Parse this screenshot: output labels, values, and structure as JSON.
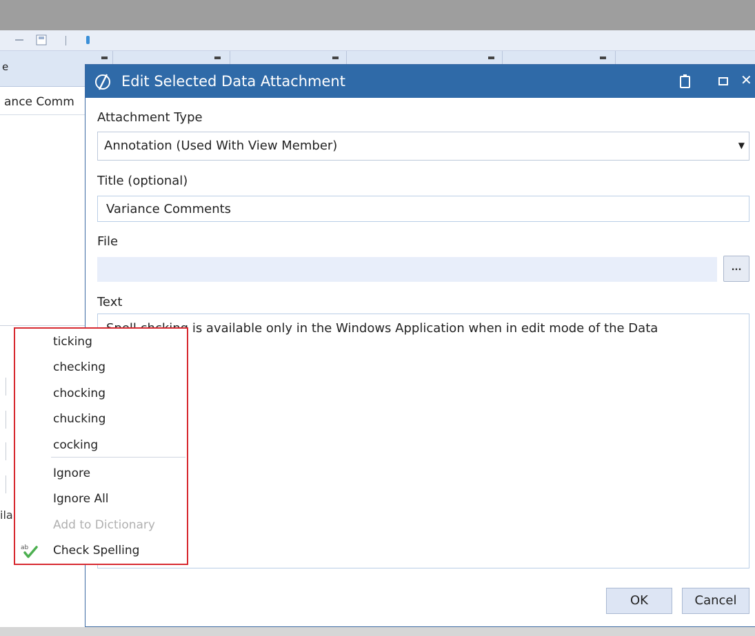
{
  "background": {
    "grid_header_label": "e",
    "grid_cell_text": "ance Comm",
    "side_text": "ila"
  },
  "dialog": {
    "title": "Edit Selected Data Attachment",
    "attachment_type": {
      "label": "Attachment Type",
      "value": "Annotation (Used With View Member)"
    },
    "title_field": {
      "label": "Title (optional)",
      "value": "Variance Comments"
    },
    "file_field": {
      "label": "File",
      "value": "",
      "browse_label": "..."
    },
    "text_field": {
      "label": "Text",
      "value": "Spell chcking is available only in the Windows Application when in edit mode of the Data Attachment."
    },
    "ok_label": "OK",
    "cancel_label": "Cancel"
  },
  "context_menu": {
    "suggestions": [
      "ticking",
      "checking",
      "chocking",
      "chucking",
      "cocking"
    ],
    "ignore": "Ignore",
    "ignore_all": "Ignore All",
    "add_to_dictionary": "Add to Dictionary",
    "check_spelling": "Check Spelling",
    "highlight_color": "#d7282f"
  },
  "colors": {
    "titlebar": "#2f6aa8",
    "button_bg": "#dde5f4"
  }
}
